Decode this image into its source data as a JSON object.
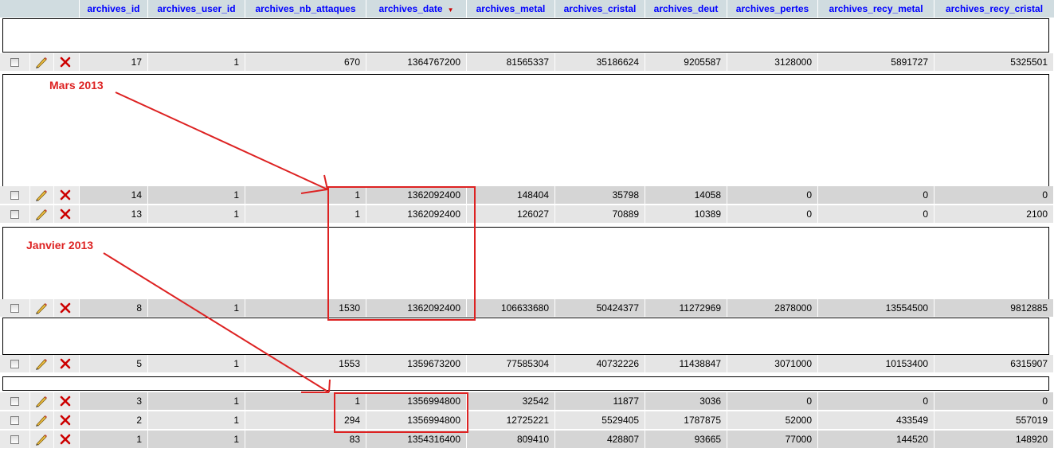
{
  "columns": [
    "archives_id",
    "archives_user_id",
    "archives_nb_attaques",
    "archives_date",
    "archives_metal",
    "archives_cristal",
    "archives_deut",
    "archives_pertes",
    "archives_recy_metal",
    "archives_recy_cristal"
  ],
  "sort_indicator": "▼",
  "rows": [
    [
      "17",
      "1",
      "670",
      "1364767200",
      "81565337",
      "35186624",
      "9205587",
      "3128000",
      "5891727",
      "5325501"
    ],
    [
      "14",
      "1",
      "1",
      "1362092400",
      "148404",
      "35798",
      "14058",
      "0",
      "0",
      "0"
    ],
    [
      "13",
      "1",
      "1",
      "1362092400",
      "126027",
      "70889",
      "10389",
      "0",
      "0",
      "2100"
    ],
    [
      "8",
      "1",
      "1530",
      "1362092400",
      "106633680",
      "50424377",
      "11272969",
      "2878000",
      "13554500",
      "9812885"
    ],
    [
      "5",
      "1",
      "1553",
      "1359673200",
      "77585304",
      "40732226",
      "11438847",
      "3071000",
      "10153400",
      "6315907"
    ],
    [
      "3",
      "1",
      "1",
      "1356994800",
      "32542",
      "11877",
      "3036",
      "0",
      "0",
      "0"
    ],
    [
      "2",
      "1",
      "294",
      "1356994800",
      "12725221",
      "5529405",
      "1787875",
      "52000",
      "433549",
      "557019"
    ],
    [
      "1",
      "1",
      "83",
      "1354316400",
      "809410",
      "428807",
      "93665",
      "77000",
      "144520",
      "148920"
    ]
  ],
  "annotations": {
    "mars": "Mars 2013",
    "janvier": "Janvier 2013"
  },
  "colors": {
    "header_bg": "#d0dce0",
    "header_text": "#0000ff",
    "annotation": "#dd2222"
  }
}
